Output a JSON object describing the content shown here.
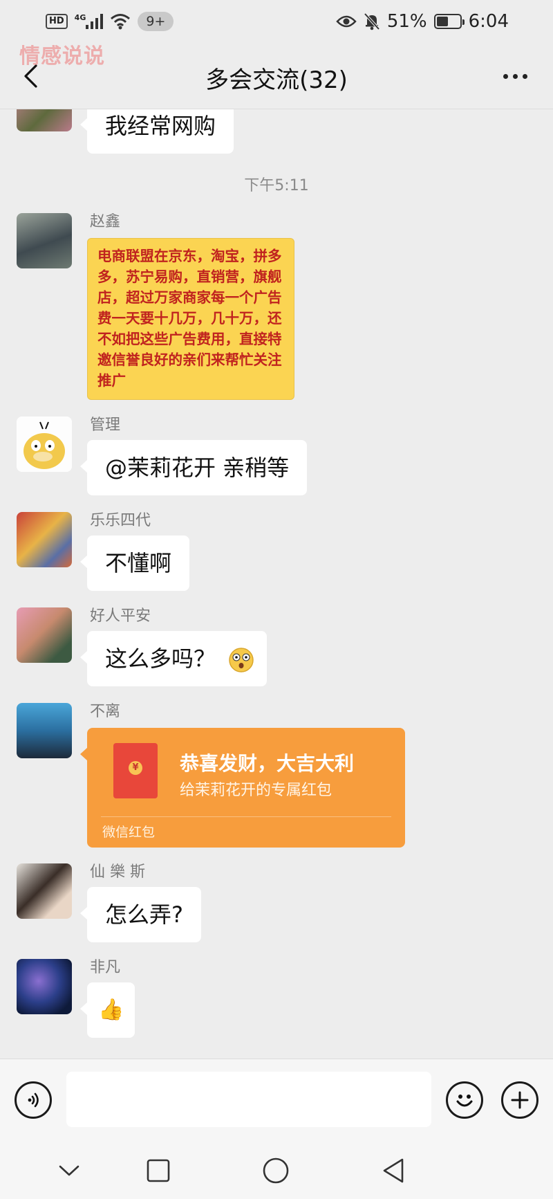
{
  "status_bar": {
    "hd": "HD",
    "network": "4G",
    "notifications": "9+",
    "battery": "51%",
    "battery_level": 0.51,
    "time": "6:04"
  },
  "watermark": "情感说说",
  "header": {
    "title": "多会交流(32)"
  },
  "chat": {
    "timestamp": "下午5:11",
    "messages": [
      {
        "sender": "",
        "text": "我经常网购"
      },
      {
        "sender": "赵鑫",
        "text": "电商联盟在京东，淘宝，拼多多，苏宁易购，直销营，旗舰店，超过万家商家每一个广告费一天要十几万，几十万，还不如把这些广告费用，直接特邀信誉良好的亲们来帮忙关注推广"
      },
      {
        "sender": "管理",
        "text": "@茉莉花开  亲稍等"
      },
      {
        "sender": "乐乐四代",
        "text": "不懂啊"
      },
      {
        "sender": "好人平安",
        "text": "这么多吗？"
      },
      {
        "sender": "不离",
        "red_packet": {
          "title": "恭喜发财，大吉大利",
          "subtitle": "给茉莉花开的专属红包",
          "footer": "微信红包",
          "coin": "¥"
        }
      },
      {
        "sender": "仙 樂 斯",
        "text": "怎么弄?"
      },
      {
        "sender": "非凡",
        "text": "👍"
      }
    ]
  },
  "input_bar": {
    "placeholder": ""
  },
  "colors": {
    "background": "#ededed",
    "bubble": "#ffffff",
    "red_packet": "#f79d3d",
    "yellow_card": "#fbd452",
    "yellow_text": "#c0231f"
  }
}
